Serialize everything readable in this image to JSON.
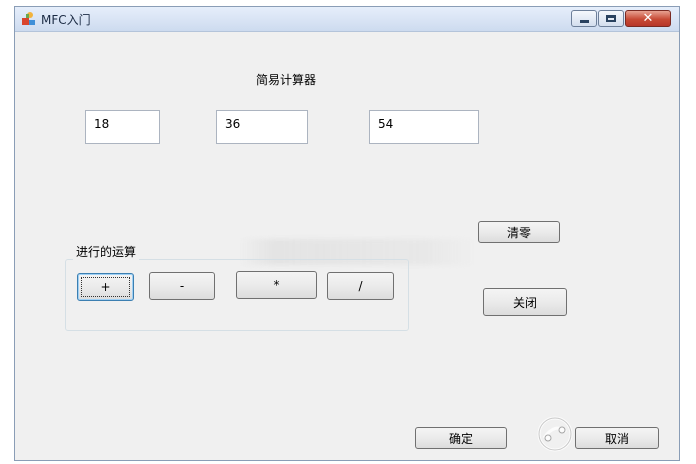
{
  "window": {
    "title": "MFC入门",
    "controls": {
      "minimize": "minimize",
      "maximize": "maximize",
      "close": "✕"
    }
  },
  "calculator": {
    "heading": "简易计算器",
    "operand1": "18",
    "operand2": "36",
    "result": "54"
  },
  "operations": {
    "group_label": "进行的运算",
    "add": "+",
    "subtract": "-",
    "multiply": "*",
    "divide": "/"
  },
  "buttons": {
    "clear": "清零",
    "close": "关闭",
    "ok": "确定",
    "cancel": "取消"
  },
  "icons": {
    "app": "mfc-app-icon",
    "watermark": "electronic-enthusiast-logo"
  },
  "colors": {
    "dialog_bg": "#f0f0f0",
    "titlebar": "#d6e2f3",
    "close_button": "#c74a35"
  }
}
